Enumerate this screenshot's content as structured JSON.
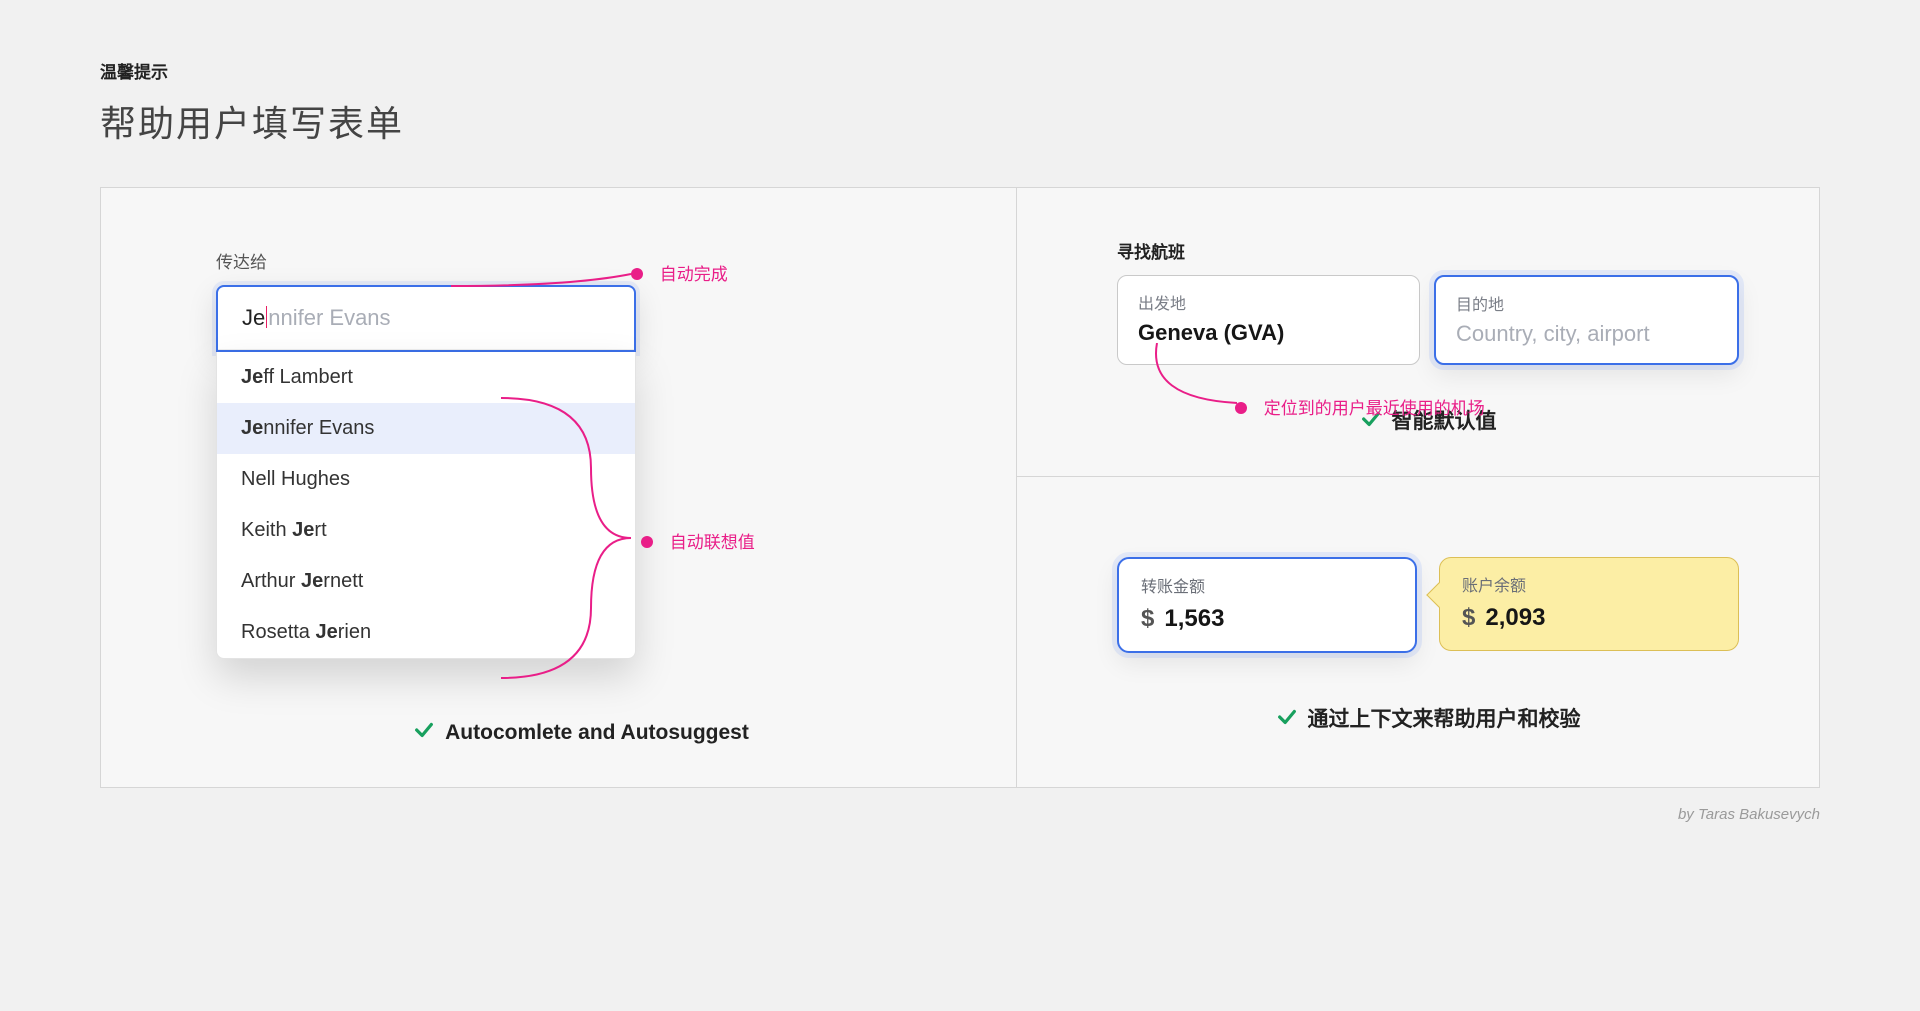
{
  "eyebrow": "温馨提示",
  "title": "帮助用户填写表单",
  "left": {
    "field_label": "传达给",
    "typed": "Je",
    "ghost": "nnifer Evans",
    "suggestions": [
      {
        "pre": "Je",
        "rest": "ff Lambert",
        "sel": false
      },
      {
        "pre": "Je",
        "rest": "nnifer Evans",
        "sel": true
      },
      {
        "pre": "",
        "rest": "Nell Hughes",
        "sel": false
      },
      {
        "pre": "",
        "rest_a": "Keith ",
        "bold": "Je",
        "rest_b": "rt",
        "sel": false
      },
      {
        "pre": "",
        "rest_a": "Arthur ",
        "bold": "Je",
        "rest_b": "rnett",
        "sel": false
      },
      {
        "pre": "",
        "rest_a": "Rosetta ",
        "bold": "Je",
        "rest_b": "rien",
        "sel": false
      }
    ],
    "anno_autocomplete": "自动完成",
    "anno_autosuggest": "自动联想值",
    "caption": "Autocomlete and Autosuggest"
  },
  "flight": {
    "section_label": "寻找航班",
    "from_label": "出发地",
    "from_value": "Geneva (GVA)",
    "to_label": "目的地",
    "to_placeholder": "Country, city, airport",
    "anno": "定位到的用户最近使用的机场",
    "caption": "智能默认值"
  },
  "amounts": {
    "transfer_label": "转账金额",
    "transfer_value": "1,563",
    "balance_label": "账户余额",
    "balance_value": "2,093",
    "currency": "$",
    "caption": "通过上下文来帮助用户和校验"
  },
  "credit": "by Taras Bakusevych"
}
